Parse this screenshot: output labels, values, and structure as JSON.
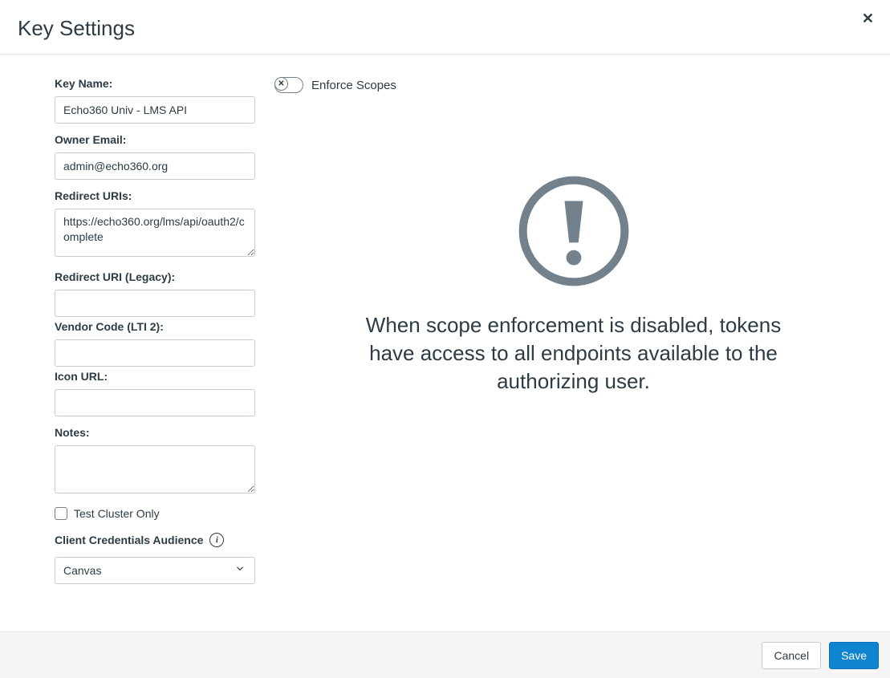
{
  "header": {
    "title": "Key Settings"
  },
  "form": {
    "key_name_label": "Key Name:",
    "key_name_value": "Echo360 Univ - LMS API",
    "owner_email_label": "Owner Email:",
    "owner_email_value": "admin@echo360.org",
    "redirect_uris_label": "Redirect URIs:",
    "redirect_uris_value": "https://echo360.org/lms/api/oauth2/complete",
    "redirect_uri_legacy_label": "Redirect URI (Legacy):",
    "redirect_uri_legacy_value": "",
    "vendor_code_label": "Vendor Code (LTI 2):",
    "vendor_code_value": "",
    "icon_url_label": "Icon URL:",
    "icon_url_value": "",
    "notes_label": "Notes:",
    "notes_value": "",
    "test_cluster_label": "Test Cluster Only",
    "client_credentials_label": "Client Credentials Audience",
    "client_credentials_value": "Canvas"
  },
  "scopes": {
    "enforce_label": "Enforce Scopes",
    "warning_text": "When scope enforcement is disabled, tokens have access to all endpoints available to the authorizing user."
  },
  "footer": {
    "cancel_label": "Cancel",
    "save_label": "Save"
  }
}
